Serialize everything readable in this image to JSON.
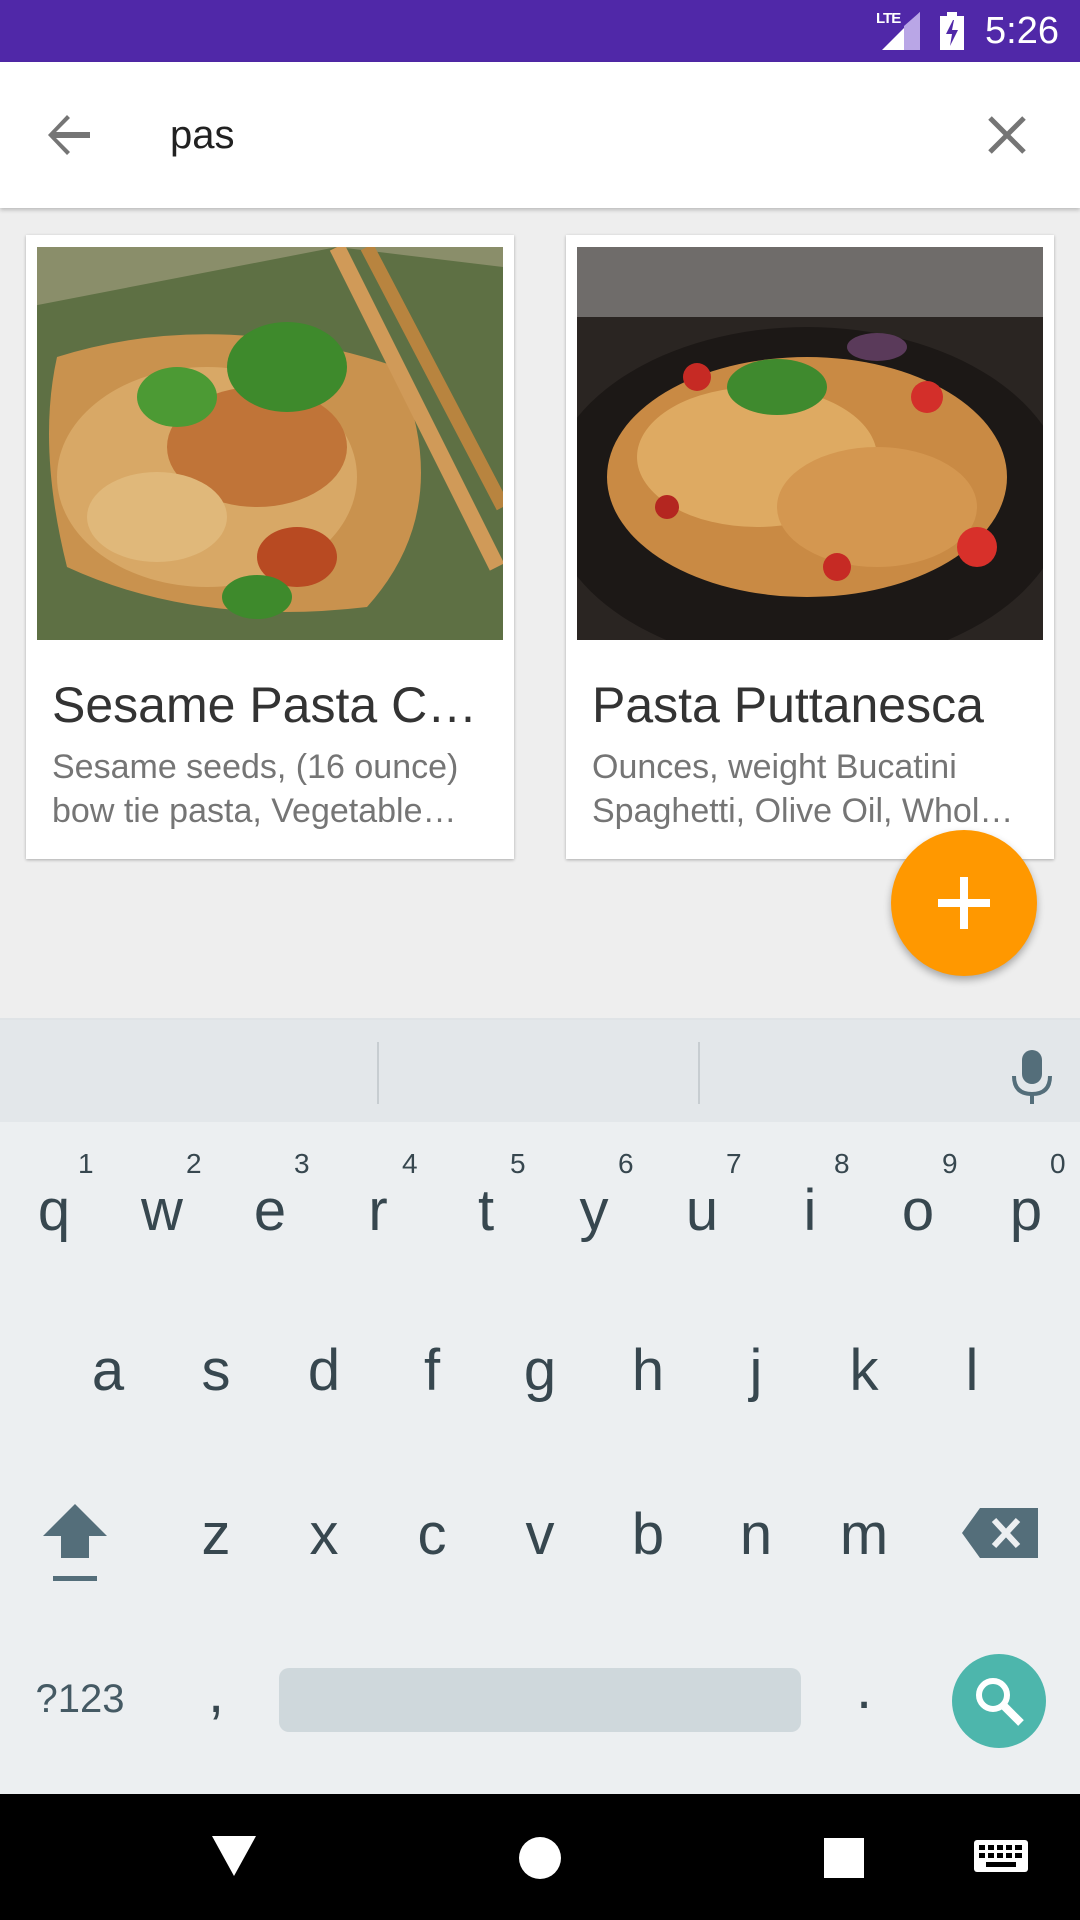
{
  "status_bar": {
    "network_label": "LTE",
    "time": "5:26"
  },
  "search": {
    "query": "pas"
  },
  "recipes": [
    {
      "title": "Sesame Pasta C…",
      "ingredients": "Sesame seeds, (16 ounce) bow tie pasta, Vegetable…"
    },
    {
      "title": "Pasta Puttanesca",
      "ingredients": "Ounces, weight Bucatini Spaghetti, Olive Oil, Whol…"
    }
  ],
  "keyboard": {
    "row1": [
      {
        "key": "q",
        "hint": "1"
      },
      {
        "key": "w",
        "hint": "2"
      },
      {
        "key": "e",
        "hint": "3"
      },
      {
        "key": "r",
        "hint": "4"
      },
      {
        "key": "t",
        "hint": "5"
      },
      {
        "key": "y",
        "hint": "6"
      },
      {
        "key": "u",
        "hint": "7"
      },
      {
        "key": "i",
        "hint": "8"
      },
      {
        "key": "o",
        "hint": "9"
      },
      {
        "key": "p",
        "hint": "0"
      }
    ],
    "row2": [
      "a",
      "s",
      "d",
      "f",
      "g",
      "h",
      "j",
      "k",
      "l"
    ],
    "row3": [
      "z",
      "x",
      "c",
      "v",
      "b",
      "n",
      "m"
    ],
    "symbols_label": "?123",
    "comma": ",",
    "period": "."
  },
  "colors": {
    "status_bar": "#5028a8",
    "fab": "#ff9800",
    "enter_key": "#4db6ac"
  },
  "icons": {
    "back": "arrow-left-icon",
    "clear": "close-icon",
    "fab": "plus-icon",
    "mic": "microphone-icon",
    "shift": "shift-arrow-icon",
    "delete": "backspace-icon",
    "enter": "search-icon",
    "nav_back": "triangle-back-icon",
    "nav_home": "circle-home-icon",
    "nav_recents": "square-recents-icon",
    "nav_keyboard": "keyboard-icon"
  }
}
